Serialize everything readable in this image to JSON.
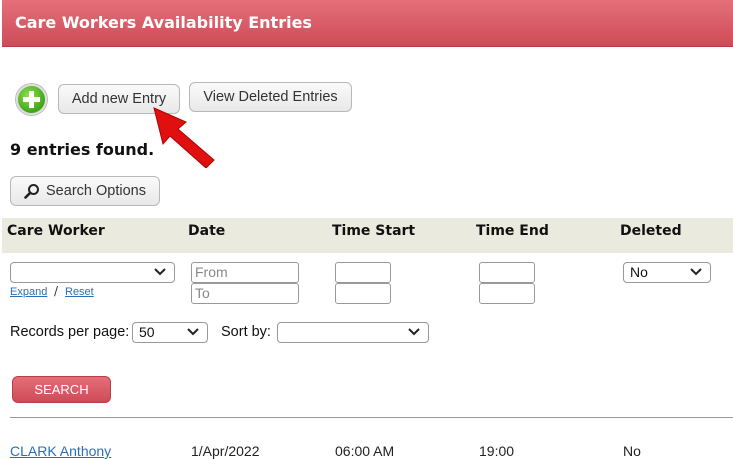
{
  "header": {
    "title": "Care Workers Availability Entries"
  },
  "toolbar": {
    "add_label": "Add new Entry",
    "view_deleted_label": "View Deleted Entries"
  },
  "entries_found": "9 entries found.",
  "search_options_label": "Search Options",
  "columns": [
    "Care Worker",
    "Date",
    "Time Start",
    "Time End",
    "Deleted"
  ],
  "filters": {
    "care_worker_value": "",
    "expand_label": "Expand",
    "reset_label": "Reset",
    "separator": "/",
    "date_from_placeholder": "From",
    "date_to_placeholder": "To",
    "deleted_value": "No"
  },
  "records_per_page_label": "Records per page:",
  "records_per_page_value": "50",
  "sort_by_label": "Sort by:",
  "sort_by_value": "",
  "search_button_label": "SEARCH",
  "rows": [
    {
      "care_worker": "CLARK Anthony",
      "date": "1/Apr/2022",
      "time_start": "06:00 AM",
      "time_end": "19:00",
      "deleted": "No"
    }
  ],
  "colors": {
    "header": "#cf4b58",
    "search_button": "#cf4a57",
    "link": "#2a6fb6",
    "table_header_bg": "#ebeadf"
  }
}
